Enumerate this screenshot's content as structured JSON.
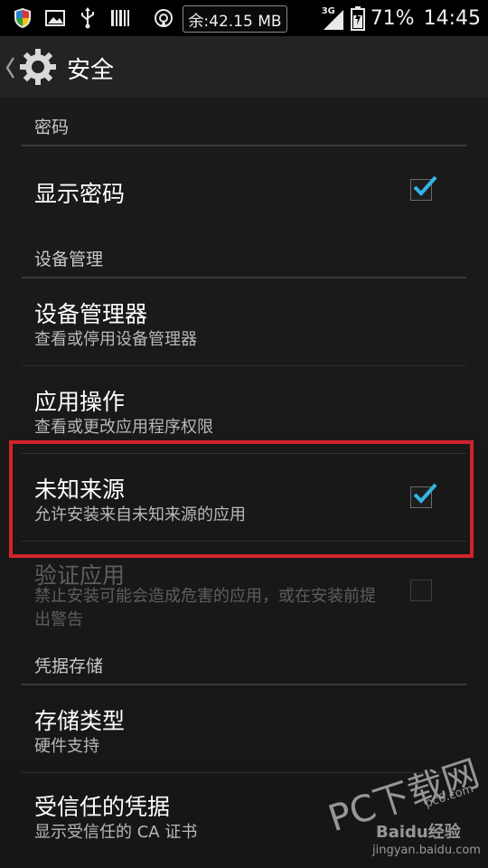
{
  "status_bar": {
    "memory": "余:42.15 MB",
    "network": "3G",
    "battery": "71%",
    "time": "14:45"
  },
  "action_bar": {
    "title": "安全"
  },
  "sections": {
    "password": {
      "header": "密码",
      "show_password": {
        "title": "显示密码",
        "checked": true
      }
    },
    "device_admin": {
      "header": "设备管理",
      "device_administrators": {
        "title": "设备管理器",
        "summary": "查看或停用设备管理器"
      },
      "app_ops": {
        "title": "应用操作",
        "summary": "查看或更改应用程序权限"
      },
      "unknown_sources": {
        "title": "未知来源",
        "summary": "允许安装来自未知来源的应用",
        "checked": true
      },
      "verify_apps": {
        "title": "验证应用",
        "summary": "禁止安装可能会造成危害的应用，或在安装前提出警告",
        "checked": false,
        "enabled": false
      }
    },
    "credential_storage": {
      "header": "凭据存储",
      "storage_type": {
        "title": "存储类型",
        "summary": "硬件支持"
      },
      "trusted_credentials": {
        "title": "受信任的凭据",
        "summary": "显示受信任的 CA 证书"
      }
    }
  },
  "watermark": {
    "brand": "PC下载网",
    "url": "pc6.com",
    "baidu": "Baidu经验",
    "baidu_url": "jingyan.baidu.com"
  },
  "colors": {
    "accent_check": "#33b5e5",
    "highlight_border": "#d0242b",
    "background": "#181818"
  }
}
